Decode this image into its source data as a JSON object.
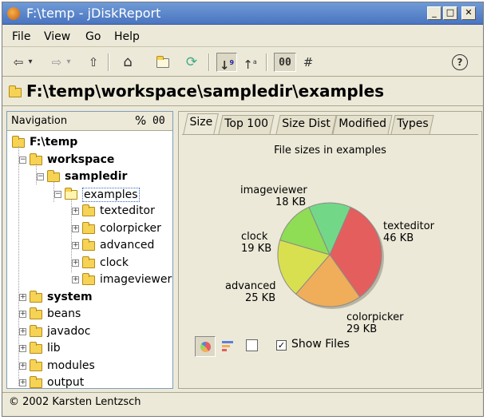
{
  "window": {
    "title": "F:\\temp - jDiskReport",
    "minimize": "_",
    "maximize": "□",
    "close": "✕"
  },
  "menu": [
    "File",
    "View",
    "Go",
    "Help"
  ],
  "toolbar": {
    "back": "⇦",
    "dropdown": "▾",
    "forward": "⇨",
    "up": "⇧",
    "home": "⌂",
    "open": "📂",
    "refresh": "⟳",
    "sort_size": "↓",
    "sort_name": "↑",
    "zeros": "00",
    "hash": "#",
    "help": "?"
  },
  "path": "F:\\temp\\workspace\\sampledir\\examples",
  "navigation": {
    "header": "Navigation",
    "percent": "%",
    "zeros": "00",
    "tree": [
      {
        "label": "F:\\temp",
        "level": 0
      },
      {
        "label": "workspace",
        "level": 1
      },
      {
        "label": "sampledir",
        "level": 2
      },
      {
        "label": "examples",
        "level": 3,
        "selected": true
      },
      {
        "label": "texteditor",
        "level": 4
      },
      {
        "label": "colorpicker",
        "level": 4
      },
      {
        "label": "advanced",
        "level": 4
      },
      {
        "label": "clock",
        "level": 4
      },
      {
        "label": "imageviewer",
        "level": 4
      },
      {
        "label": "system",
        "level": 1
      },
      {
        "label": "beans",
        "level": 1
      },
      {
        "label": "javadoc",
        "level": 1
      },
      {
        "label": "lib",
        "level": 1
      },
      {
        "label": "modules",
        "level": 1
      },
      {
        "label": "output",
        "level": 1
      }
    ]
  },
  "tabs": [
    "Size",
    "Top 100",
    "Size Dist",
    "Modified",
    "Types"
  ],
  "chart_data": {
    "type": "pie",
    "title": "File sizes in examples",
    "slices": [
      {
        "label": "texteditor",
        "value_label": "46 KB",
        "value": 46,
        "color": "#e45e5e"
      },
      {
        "label": "colorpicker",
        "value_label": "29 KB",
        "value": 29,
        "color": "#f0ad5a"
      },
      {
        "label": "advanced",
        "value_label": "25 KB",
        "value": 25,
        "color": "#d8e050"
      },
      {
        "label": "clock",
        "value_label": "19 KB",
        "value": 19,
        "color": "#8fdc55"
      },
      {
        "label": "imageviewer",
        "value_label": "18 KB",
        "value": 18,
        "color": "#72d887"
      }
    ]
  },
  "bottom": {
    "show_files": "Show Files",
    "show_files_checked": true
  },
  "status": "© 2002 Karsten Lentzsch"
}
